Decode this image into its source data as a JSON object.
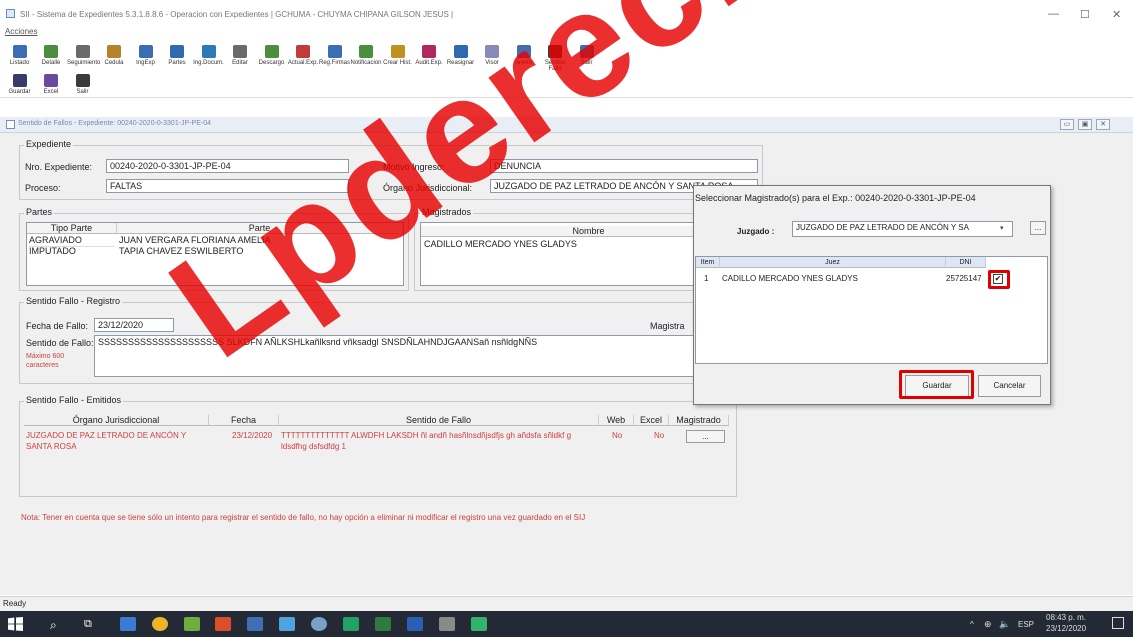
{
  "window": {
    "title": "SII - Sistema de Expedientes 5.3.1.8.8.6 - Operacion con Expedientes  | GCHUMA - CHUYMA CHIPANA GILSON JESUS |",
    "minimize": "—",
    "maximize": "☐",
    "close": "✕"
  },
  "menu": {
    "acciones": "Acciones"
  },
  "toolbar": {
    "row1": [
      "Listado",
      "Detalle",
      "Seguimiento",
      "Cedula",
      "IngExp",
      "Partes",
      "Ing.Docum.",
      "Editar",
      "Descargo",
      "Actual.Exp.",
      "Reg.Firmas",
      "Notificacion",
      "Crear Hist.",
      "Audit.Exp.",
      "Reasignar",
      "Visor",
      "Anexo",
      "Sentido Fallo",
      "Salir"
    ],
    "row2": [
      "Guardar",
      "Excel",
      "Salir"
    ]
  },
  "mdi": {
    "title": "Sentido de Fallos - Expediente: 00240-2020-0-3301-JP-PE-04",
    "buttons": [
      "▭",
      "▣",
      "✕"
    ]
  },
  "expediente": {
    "group_label": "Expediente",
    "nro_label": "Nro. Expediente:",
    "nro_value": "00240-2020-0-3301-JP-PE-04",
    "proceso_label": "Proceso:",
    "proceso_value": "FALTAS",
    "motivo_label": "Motivo Ingreso:",
    "motivo_value": "DENUNCIA",
    "organo_label": "Órgano Jurisdiccional:",
    "organo_value": "JUZGADO DE PAZ LETRADO DE ANCÓN Y SANTA ROSA"
  },
  "partes": {
    "group_label": "Partes",
    "headers": [
      "Tipo Parte",
      "Parte"
    ],
    "rows": [
      [
        "AGRAVIADO",
        "JUAN VERGARA FLORIANA AMELIA"
      ],
      [
        "IMPUTADO",
        "TAPIA CHAVEZ ESWILBERTO"
      ]
    ]
  },
  "magistrados": {
    "group_label": "Magistrados",
    "header": "Nombre",
    "rows": [
      "CADILLO MERCADO YNES GLADYS"
    ]
  },
  "registro": {
    "group_label": "Sentido Fallo - Registro",
    "fecha_label": "Fecha de Fallo:",
    "fecha_value": "23/12/2020",
    "sentido_label": "Sentido de Fallo:",
    "sentido_value": "SSSSSSSSSSSSSSSSSSSSS SLKDFN AÑLKSHLkañlksnd vñksadgl SNSDÑLAHNDJGAANSañ nsñldgNÑS",
    "max_label": "Máximo 600 caracteres",
    "magistrado_label": "Magistra"
  },
  "emitidos": {
    "group_label": "Sentido Fallo - Emitidos",
    "headers": [
      "Órgano Jurisdiccional",
      "Fecha",
      "Sentido de Fallo",
      "Web",
      "Excel",
      "Magistrado"
    ],
    "row": {
      "organo": "JUZGADO DE PAZ LETRADO DE ANCÓN Y SANTA ROSA",
      "fecha": "23/12/2020",
      "sentido": "TTTTTTTTTTTTTT ALWDFH LAKSDH ñl andñ hasñlnsdñjsdfjs gh añdsfa sñldkf g ldsdfhg dsfsdfdg 1",
      "web": "No",
      "excel": "No",
      "btn": "..."
    }
  },
  "nota": "Nota: Tener en cuenta que se tiene sólo un intento para registrar el sentido de fallo, no hay opción a eliminar ni modificar el registro una vez guardado en  el SIJ",
  "dialog": {
    "title": "Seleccionar Magistrado(s) para el Exp.: 00240-2020-0-3301-JP-PE-04",
    "juzgado_label": "Juzgado :",
    "juzgado_value": "JUZGADO DE PAZ LETRADO DE ANCÓN Y SA",
    "more": "...",
    "headers": [
      "Item",
      "Juez",
      "DNI"
    ],
    "rows": [
      {
        "item": "1",
        "juez": "CADILLO MERCADO YNES GLADYS",
        "dni": "25725147",
        "checked": "✔"
      }
    ],
    "guardar": "Guardar",
    "cancelar": "Cancelar"
  },
  "status": {
    "ready": "Ready"
  },
  "taskbar": {
    "lang": "ESP",
    "time": "08:43 p. m.",
    "date": "23/12/2020",
    "tray": "^"
  },
  "watermark": "Lpderecho",
  "colors": {
    "accent_red": "#e00000",
    "taskbar": "#232a36"
  }
}
